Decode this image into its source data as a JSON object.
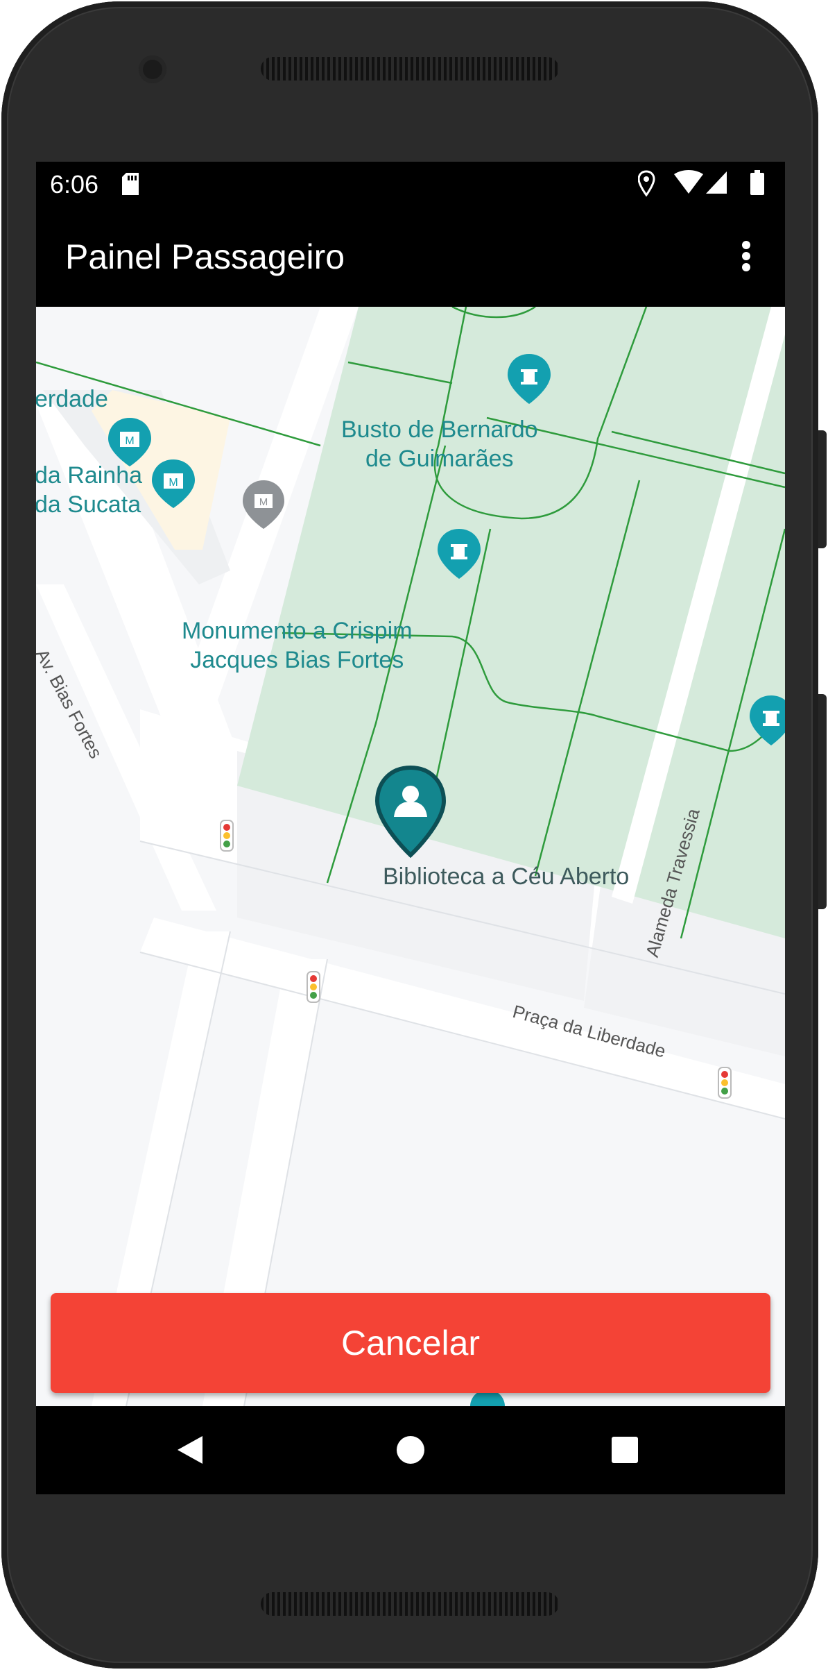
{
  "status_bar": {
    "time": "6:06",
    "icons": [
      "sd-card-icon",
      "location-icon",
      "wifi-icon",
      "signal-icon",
      "battery-icon"
    ]
  },
  "app_bar": {
    "title": "Painel Passageiro",
    "menu_icon": "overflow-menu-icon"
  },
  "map": {
    "places": [
      {
        "label": "erdade",
        "icon": "museum-icon"
      },
      {
        "label": "da Rainha\nda Sucata",
        "icon": "museum-icon"
      },
      {
        "label": "Busto de Bernardo\nde Guimarães",
        "icon": "monument-icon"
      },
      {
        "label": "Monumento a Crispim\nJacques Bias Fortes",
        "icon": "monument-icon"
      },
      {
        "label": "Biblioteca a Céu Aberto",
        "icon": "user-location-icon"
      }
    ],
    "streets": [
      "Av. Bias Fortes",
      "Alameda Travessia",
      "Praça da Liberdade"
    ]
  },
  "actions": {
    "cancel_label": "Cancelar"
  },
  "nav": {
    "back": "back-icon",
    "home": "home-icon",
    "recents": "recents-icon"
  },
  "colors": {
    "accent": "#f44336",
    "park": "#d5eadb",
    "poi": "#1e8a8e",
    "park_path": "#2e9b3c"
  }
}
